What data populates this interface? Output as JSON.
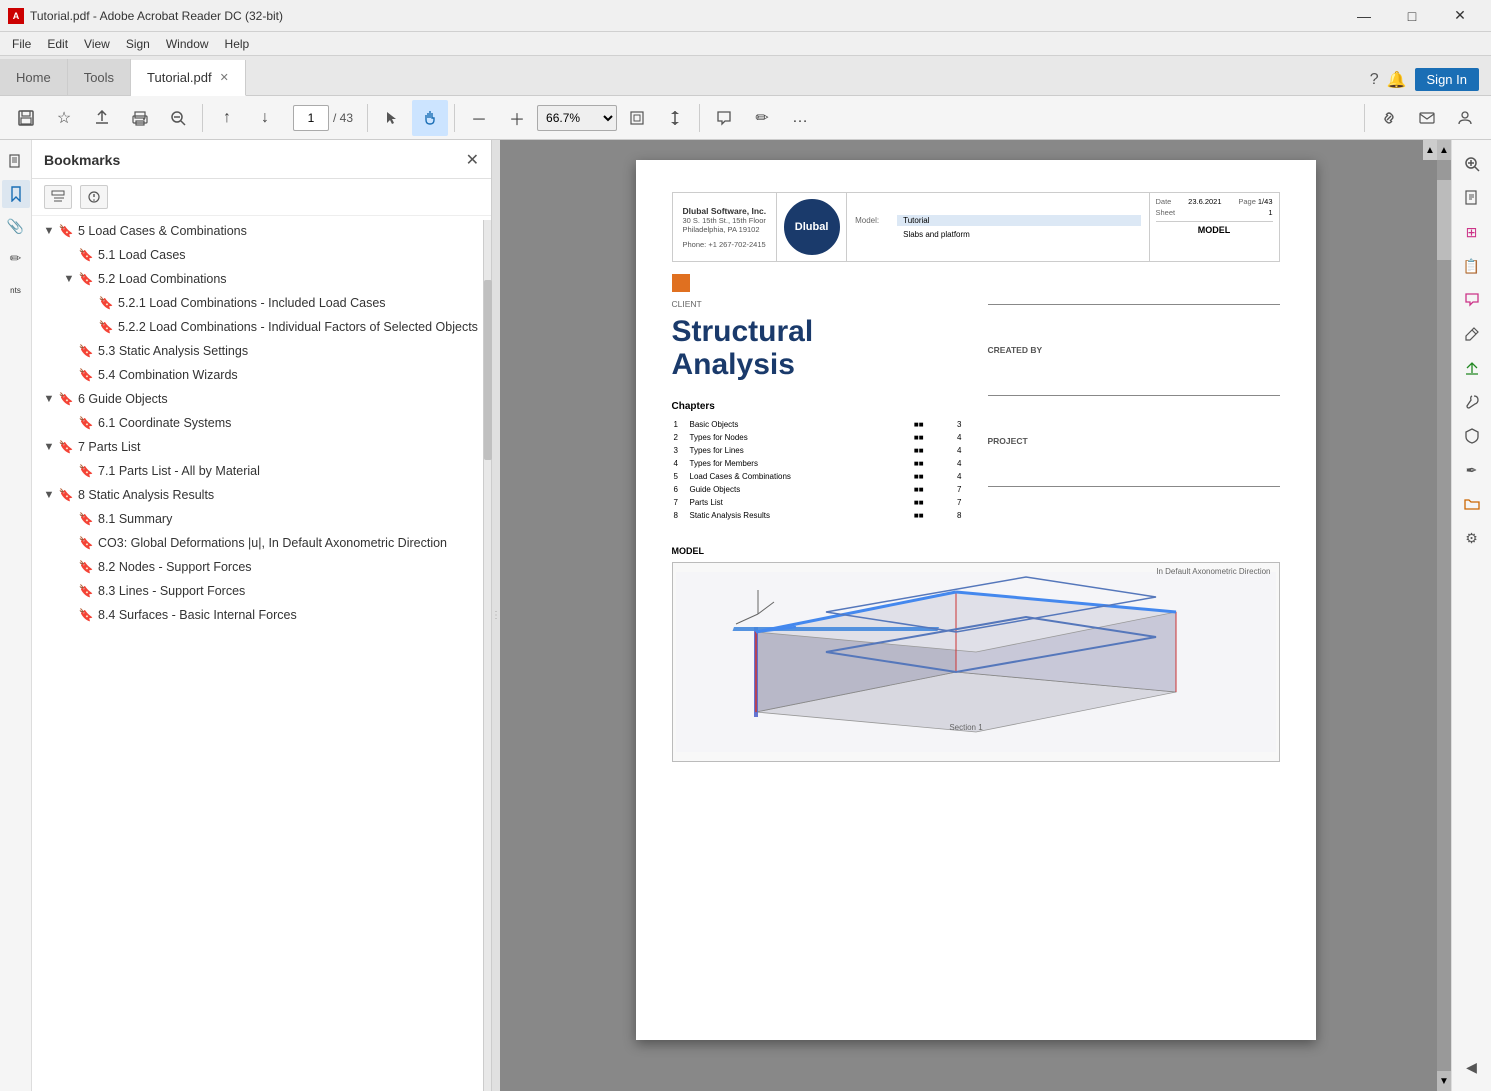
{
  "window": {
    "title": "Tutorial.pdf - Adobe Acrobat Reader DC (32-bit)",
    "icon": "A",
    "controls": {
      "minimize": "—",
      "maximize": "□",
      "close": "✕"
    }
  },
  "menu": {
    "items": [
      "File",
      "Edit",
      "View",
      "Sign",
      "Window",
      "Help"
    ]
  },
  "tabs": [
    {
      "label": "Home",
      "active": false
    },
    {
      "label": "Tools",
      "active": false
    },
    {
      "label": "Tutorial.pdf",
      "active": true,
      "closeable": true
    }
  ],
  "tab_bar_right": {
    "help": "?",
    "bell": "🔔",
    "signin": "Sign In"
  },
  "toolbar": {
    "save": "💾",
    "bookmark": "☆",
    "upload": "⬆",
    "print": "🖨",
    "zoom_out_glass": "🔍",
    "prev_page": "↑",
    "next_page": "↓",
    "page_current": "1",
    "page_total": "/ 43",
    "cursor": "↖",
    "hand": "✋",
    "zoom_out": "－",
    "zoom_in": "＋",
    "zoom_level": "66.7%",
    "fit_page": "⊞",
    "scroll": "↕",
    "comment": "💬",
    "pen": "✏",
    "more": "…",
    "link": "🔗",
    "mail": "✉",
    "person": "👤"
  },
  "bookmarks": {
    "title": "Bookmarks",
    "items": [
      {
        "level": 1,
        "text": "5 Load Cases & Combinations",
        "expanded": true,
        "icon": "bookmark"
      },
      {
        "level": 2,
        "text": "5.1 Load Cases",
        "icon": "bookmark"
      },
      {
        "level": 2,
        "text": "5.2 Load Combinations",
        "expanded": true,
        "icon": "bookmark"
      },
      {
        "level": 3,
        "text": "5.2.1 Load Combinations - Included Load Cases",
        "icon": "bookmark"
      },
      {
        "level": 3,
        "text": "5.2.2 Load Combinations - Individual Factors of Selected Objects",
        "icon": "bookmark"
      },
      {
        "level": 2,
        "text": "5.3 Static Analysis Settings",
        "icon": "bookmark"
      },
      {
        "level": 2,
        "text": "5.4 Combination Wizards",
        "icon": "bookmark"
      },
      {
        "level": 1,
        "text": "6 Guide Objects",
        "expanded": true,
        "icon": "bookmark"
      },
      {
        "level": 2,
        "text": "6.1 Coordinate Systems",
        "icon": "bookmark"
      },
      {
        "level": 1,
        "text": "7 Parts List",
        "expanded": true,
        "icon": "bookmark"
      },
      {
        "level": 2,
        "text": "7.1 Parts List - All by Material",
        "icon": "bookmark"
      },
      {
        "level": 1,
        "text": "8 Static Analysis Results",
        "expanded": true,
        "icon": "bookmark"
      },
      {
        "level": 2,
        "text": "8.1 Summary",
        "icon": "bookmark"
      },
      {
        "level": 2,
        "text": "CO3: Global Deformations |u|, In Default Axonometric Direction",
        "icon": "bookmark"
      },
      {
        "level": 2,
        "text": "8.2 Nodes - Support Forces",
        "icon": "bookmark"
      },
      {
        "level": 2,
        "text": "8.3 Lines - Support Forces",
        "icon": "bookmark"
      },
      {
        "level": 2,
        "text": "8.4 Surfaces - Basic Internal Forces",
        "icon": "bookmark"
      }
    ]
  },
  "pdf": {
    "company": {
      "name": "Dlubal Software, Inc.",
      "address": "30 S. 15th St., 15th Floor",
      "city": "Philadelphia, PA 19102",
      "phone": "Phone: +1 267-702-2415"
    },
    "header_right": {
      "model_label": "Model:",
      "model_val": "Tutorial",
      "subtitle_label": "",
      "subtitle_val": "Slabs and platform",
      "date_label": "Date",
      "date_val": "23.6.2021",
      "page_label": "Page",
      "page_val": "1/43",
      "sheet_label": "Sheet",
      "sheet_val": "1"
    },
    "model_section": "MODEL",
    "client_label": "CLIENT",
    "main_title_line1": "Structural",
    "main_title_line2": "Analysis",
    "created_by": "CREATED BY",
    "project": "PROJECT",
    "toc_title": "Chapters",
    "toc_items": [
      {
        "num": "1",
        "label": "Basic Objects",
        "page": "3"
      },
      {
        "num": "2",
        "label": "Types for Nodes",
        "page": "4"
      },
      {
        "num": "3",
        "label": "Types for Lines",
        "page": "4"
      },
      {
        "num": "4",
        "label": "Types for Members",
        "page": "4"
      },
      {
        "num": "5",
        "label": "Load Cases & Combinations",
        "page": "4"
      },
      {
        "num": "6",
        "label": "Guide Objects",
        "page": "7"
      },
      {
        "num": "7",
        "label": "Parts List",
        "page": "7"
      },
      {
        "num": "8",
        "label": "Static Analysis Results",
        "page": "8"
      }
    ],
    "model_3d_label": "In Default Axonometric Direction"
  },
  "left_sidebar": {
    "icons": [
      "📄",
      "⭐",
      "📎",
      "✏",
      "nts"
    ]
  },
  "right_sidebar": {
    "icons": [
      {
        "symbol": "🔍",
        "color": "normal"
      },
      {
        "symbol": "📄",
        "color": "normal"
      },
      {
        "symbol": "⊞",
        "color": "pink"
      },
      {
        "symbol": "📋",
        "color": "normal"
      },
      {
        "symbol": "💬",
        "color": "pink"
      },
      {
        "symbol": "📝",
        "color": "normal"
      },
      {
        "symbol": "⬆",
        "color": "green"
      },
      {
        "symbol": "🔧",
        "color": "normal"
      },
      {
        "symbol": "🛡",
        "color": "normal"
      },
      {
        "symbol": "✒",
        "color": "normal"
      },
      {
        "symbol": "📁",
        "color": "orange"
      },
      {
        "symbol": "⚙",
        "color": "normal"
      }
    ]
  }
}
